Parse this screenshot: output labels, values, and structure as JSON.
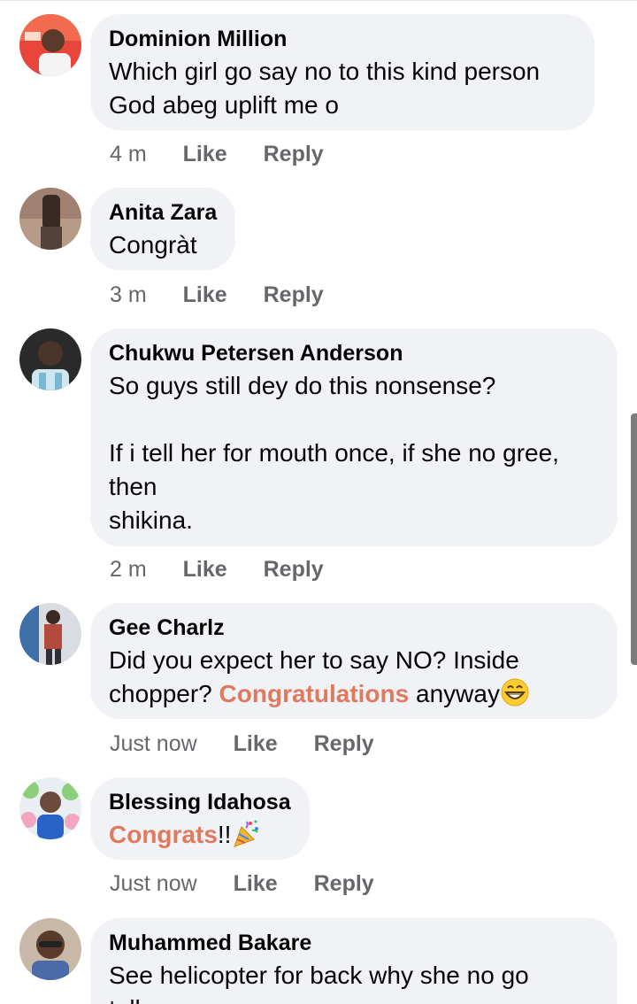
{
  "comments": [
    {
      "author": "Dominion Million",
      "lines": [
        "Which girl go say no to this kind person",
        "God abeg uplift me o"
      ],
      "time": "4 m",
      "like": "Like",
      "reply": "Reply"
    },
    {
      "author": "Anita Zara",
      "lines": [
        "Congràt"
      ],
      "time": "3 m",
      "like": "Like",
      "reply": "Reply"
    },
    {
      "author": "Chukwu Petersen Anderson",
      "lines": [
        "So guys still dey do this nonsense?",
        "",
        "If i tell her for mouth once, if she no gree,",
        "then",
        "shikina."
      ],
      "time": "2 m",
      "like": "Like",
      "reply": "Reply"
    },
    {
      "author": "Gee Charlz",
      "line1": "Did you expect her to say NO? Inside",
      "line2_prefix": "chopper?",
      "line2_link": "Congratulations",
      "line2_suffix": "anyway",
      "emoji": "grinning-face-emoji",
      "time": "Just now",
      "like": "Like",
      "reply": "Reply"
    },
    {
      "author": "Blessing Idahosa",
      "link": "Congrats",
      "suffix": "!!",
      "emoji": "party-popper-emoji",
      "time": "Just now",
      "like": "Like",
      "reply": "Reply"
    },
    {
      "author": "Muhammed Bakare",
      "lines": [
        "See helicopter for back why she no go",
        "t..ll..."
      ]
    }
  ],
  "colors": {
    "bubble": "#f0f2f5",
    "text": "#050505",
    "meta": "#65676b",
    "hashtag_link": "#e07a5f"
  }
}
